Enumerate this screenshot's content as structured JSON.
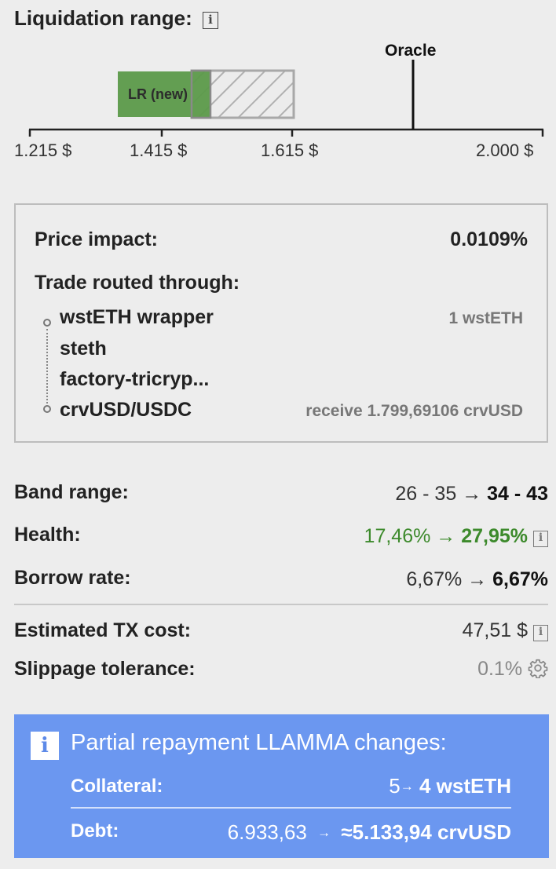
{
  "liquidation": {
    "title": "Liquidation range:",
    "info_icon": "i",
    "oracle_label": "Oracle",
    "lr_new_label": "LR (new)",
    "axis_labels": [
      "1.215 $",
      "1.415 $",
      "1.615 $",
      "2.000 $"
    ],
    "colors": {
      "new_range": "#5c9a4a",
      "old_range_hatch": "#b0b0b0"
    }
  },
  "summary": {
    "price_impact_label": "Price impact:",
    "price_impact_value": "0.0109%",
    "routed_label": "Trade routed through:",
    "route": [
      {
        "name": "wstETH wrapper",
        "detail": "1 wstETH"
      },
      {
        "name": "steth",
        "detail": ""
      },
      {
        "name": "factory-tricryp...",
        "detail": ""
      },
      {
        "name": "crvUSD/USDC",
        "detail": "receive 1.799,69106 crvUSD"
      }
    ]
  },
  "details": {
    "band_range": {
      "label": "Band range:",
      "from": "26 - 35",
      "arrow": "→",
      "to": "34 - 43"
    },
    "health": {
      "label": "Health:",
      "from": "17,46%",
      "arrow": "→",
      "to": "27,95%"
    },
    "borrow_rate": {
      "label": "Borrow rate:",
      "from": "6,67%",
      "arrow": "→",
      "to": "6,67%"
    },
    "tx_cost": {
      "label": "Estimated TX cost:",
      "value": "47,51 $"
    },
    "slippage": {
      "label": "Slippage tolerance:",
      "value": "0.1%"
    }
  },
  "changes": {
    "title": "Partial repayment LLAMMA changes:",
    "collateral_label": "Collateral:",
    "collateral_from": "5",
    "collateral_arrow": "→",
    "collateral_to": "4 wstETH",
    "debt_label": "Debt:",
    "debt_from": "6.933,63",
    "debt_arrow": "→",
    "debt_to": "≈5.133,94 crvUSD",
    "accent": "#6b97f0"
  }
}
